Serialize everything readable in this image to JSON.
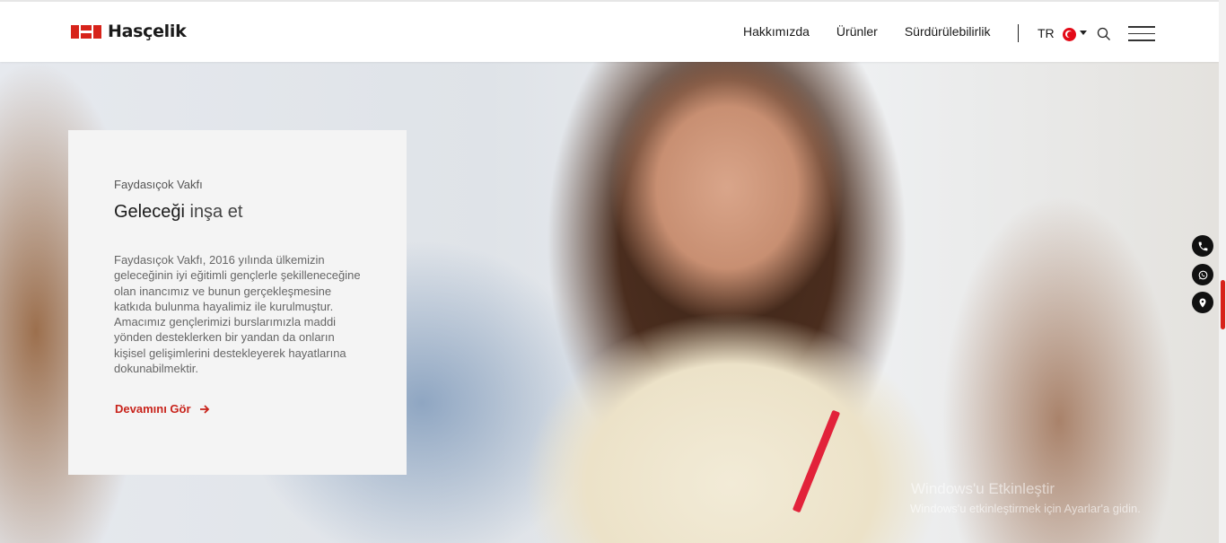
{
  "brand": {
    "name": "Hasçelik",
    "color": "#d7231a"
  },
  "nav": {
    "items": [
      "Hakkımızda",
      "Ürünler",
      "Sürdürülebilirlik"
    ]
  },
  "header": {
    "language": "TR",
    "flag_icon": "turkey-flag-icon"
  },
  "card": {
    "eyebrow": "Faydasıçok Vakfı",
    "title_strong": "Geleceği",
    "title_light": " inşa et",
    "body": "Faydasıçok Vakfı, 2016 yılında ülkemizin geleceğinin iyi eğitimli gençlerle şekilleneceğine olan inancımız ve bunun gerçekleşmesine katkıda bulunma hayalimiz ile kurulmuştur. Amacımız gençlerimizi burslarımızla maddi yönden desteklerken bir yandan da onların kişisel gelişimlerini destekleyerek hayatlarına dokunabilmektir.",
    "cta": "Devamını Gör"
  },
  "side_actions": [
    "phone-icon",
    "whatsapp-icon",
    "location-pin-icon"
  ],
  "watermark": {
    "title": "Windows'u Etkinleştir",
    "subtitle": "Windows'u etkinleştirmek için Ayarlar'a gidin."
  }
}
